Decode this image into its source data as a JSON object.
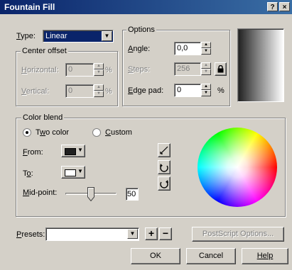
{
  "dialog": {
    "title": "Fountain Fill",
    "help_glyph": "?",
    "close_glyph": "×"
  },
  "type": {
    "label": "Type:",
    "value": "Linear"
  },
  "options": {
    "group_label": "Options",
    "angle": {
      "label": "Angle:",
      "value": "0,0"
    },
    "steps": {
      "label": "Steps:",
      "value": "256"
    },
    "edge_pad": {
      "label": "Edge pad:",
      "value": "0",
      "unit": "%"
    }
  },
  "center_offset": {
    "group_label": "Center offset",
    "horizontal": {
      "label": "Horizontal:",
      "value": "0",
      "unit": "%"
    },
    "vertical": {
      "label": "Vertical:",
      "value": "0",
      "unit": "%"
    }
  },
  "color_blend": {
    "group_label": "Color blend",
    "two_color": {
      "label": "Two color",
      "selected": true
    },
    "custom": {
      "label": "Custom",
      "selected": false
    },
    "from": {
      "label": "From:",
      "color": "#202020"
    },
    "to": {
      "label": "To:",
      "color": "#ffffff"
    },
    "mid_point": {
      "label": "Mid-point:",
      "value": "50",
      "fraction": 0.5
    }
  },
  "presets": {
    "label": "Presets:",
    "value": ""
  },
  "buttons": {
    "add": "+",
    "remove": "−",
    "postscript": "PostScript Options...",
    "ok": "OK",
    "cancel": "Cancel",
    "help": "Help"
  },
  "preview": {
    "from_color": "#202020",
    "to_color": "#ffffff"
  }
}
